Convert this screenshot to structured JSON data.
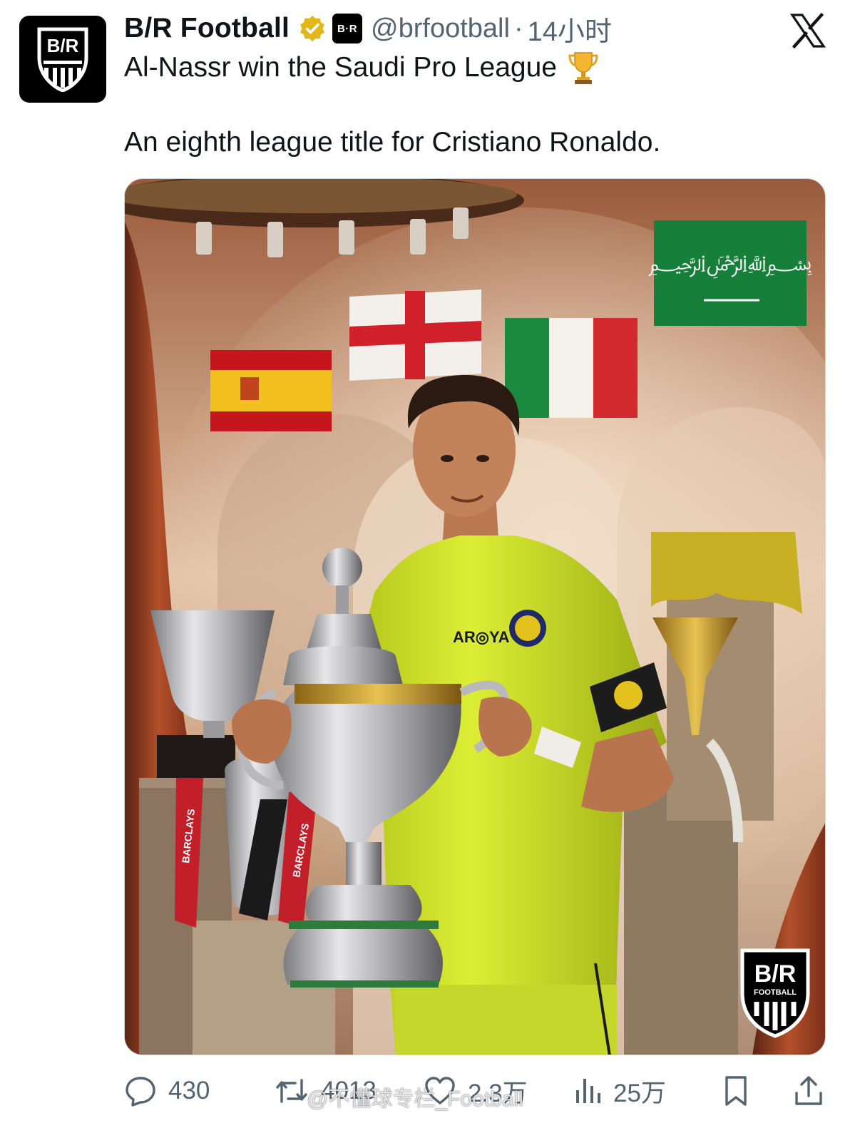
{
  "author": {
    "display_name": "B/R Football",
    "handle": "@brfootball",
    "separator": "·",
    "time": "14小时",
    "avatar_text": "B/R",
    "affiliate_badge": "B·R"
  },
  "tweet": {
    "line1": "Al-Nassr win the Saudi Pro League",
    "line2": "An eighth league title for Cristiano Ronaldo."
  },
  "media": {
    "logo_text": "B/R",
    "logo_subtext": "FOOTBALL",
    "sponsor_text": "AR◎YA",
    "ribbon_text": "BARCLAYS"
  },
  "actions": {
    "replies": "430",
    "reposts": "4013",
    "likes": "2.3万",
    "views": "25万"
  },
  "watermark": "@不懂球专栏_Football",
  "colors": {
    "verified": "#e2b719",
    "text": "#0f1419",
    "secondary": "#536471",
    "jersey": "#d6e82a"
  },
  "icons": [
    "verified-badge-icon",
    "x-logo-icon",
    "trophy-emoji-icon",
    "reply-icon",
    "repost-icon",
    "like-icon",
    "views-icon",
    "bookmark-icon",
    "share-icon"
  ]
}
